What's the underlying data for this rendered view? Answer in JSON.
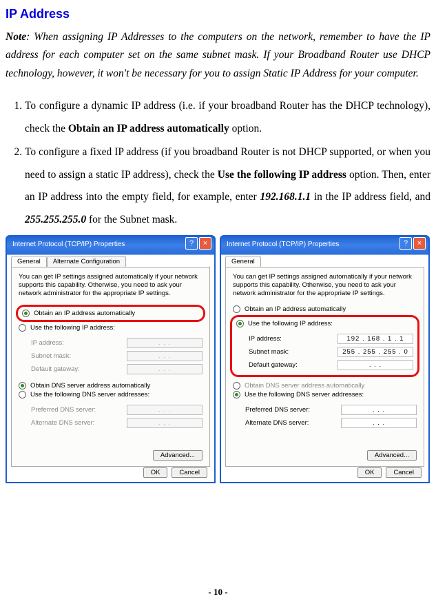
{
  "title": "IP Address",
  "note_label": "Note",
  "note_body": ": When assigning IP Addresses to the computers on the network, remember to have the IP address for each computer set on the same subnet mask. If your Broadband Router use DHCP technology, however, it won't be necessary for you to assign Static IP Address for your computer.",
  "steps": {
    "s1_a": "To configure a dynamic IP address (i.e. if your broadband Router has the DHCP technology), check the ",
    "s1_b": "Obtain an IP address automatically",
    "s1_c": " option.",
    "s2_a": "To configure a fixed IP address (if you broadband Router is not DHCP supported, or when you need to assign a static IP address), check the ",
    "s2_b1": "Use the following IP address",
    "s2_c": " option. Then, enter an IP address into the empty field, for example, enter ",
    "s2_ip": "192.168.1.1",
    "s2_d": " in the IP address field, and ",
    "s2_mask": "255.255.255.0",
    "s2_e": " for the Subnet mask."
  },
  "dlg": {
    "title": "Internet Protocol (TCP/IP) Properties",
    "tab_general": "General",
    "tab_alt": "Alternate Configuration",
    "intro": "You can get IP settings assigned automatically if your network supports this capability. Otherwise, you need to ask your network administrator for the appropriate IP settings.",
    "r_obtain_ip": "Obtain an IP address automatically",
    "r_use_ip": "Use the following IP address:",
    "f_ip": "IP address:",
    "f_subnet": "Subnet mask:",
    "f_gw": "Default gateway:",
    "r_obtain_dns": "Obtain DNS server address automatically",
    "r_use_dns": "Use the following DNS server addresses:",
    "f_pdns": "Preferred DNS server:",
    "f_adns": "Alternate DNS server:",
    "adv": "Advanced...",
    "ok": "OK",
    "cancel": "Cancel",
    "ip_val": "192 . 168 .  1  .  1",
    "mask_val": "255 . 255 . 255 .  0",
    "dots": ".       .       ."
  },
  "page_num": "- 10 -"
}
